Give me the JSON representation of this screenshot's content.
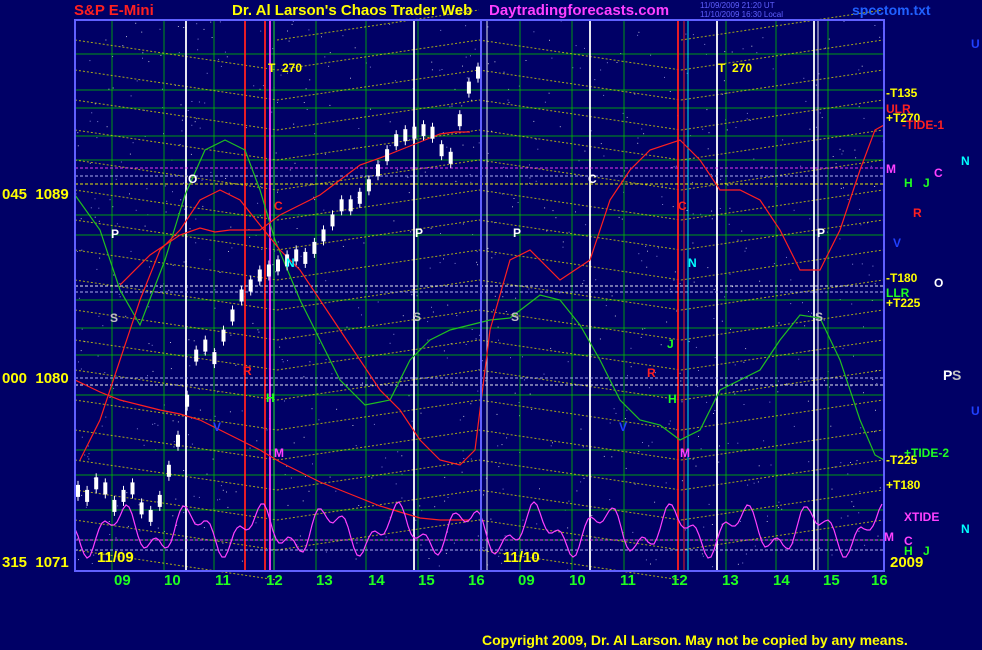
{
  "header": {
    "instrument": "S&P E-Mini",
    "title": "Dr. Al Larson's Chaos Trader Web",
    "site": "Daytradingforecasts.com",
    "stamp1": "11/09/2009 21:20 UT",
    "stamp2": "11/10/2009 16:30 Local",
    "file": "spcctom.txt"
  },
  "footer": {
    "copyright": "Copyright 2009, Dr. Al Larson. May not be copied by any means."
  },
  "y_labels": [
    {
      "deg": "045",
      "price": "1089"
    },
    {
      "deg": "000",
      "price": "1080"
    },
    {
      "deg": "315",
      "price": "1071"
    }
  ],
  "dates": {
    "day1": "11/09",
    "day2": "11/10",
    "year": "2009"
  },
  "x_ticks": [
    "09",
    "10",
    "11",
    "12",
    "13",
    "14",
    "15",
    "16",
    "09",
    "10",
    "11",
    "12",
    "13",
    "14",
    "15",
    "16"
  ],
  "top_markers": [
    {
      "text": "T  270"
    },
    {
      "text": "T  270"
    }
  ],
  "right_labels": [
    {
      "text": "-T135",
      "color": "#ffff00"
    },
    {
      "text": "ULR",
      "color": "#ff2020"
    },
    {
      "text": "+T270",
      "color": "#ffff00"
    },
    {
      "text": "-TIDE-1",
      "color": "#ff2020"
    },
    {
      "text": "M",
      "color": "#ff40ff"
    },
    {
      "text": "C",
      "color": "#ff40ff"
    },
    {
      "text": "N",
      "color": "#00ffff"
    },
    {
      "text": "H",
      "color": "#20ff20"
    },
    {
      "text": "J",
      "color": "#20ff20"
    },
    {
      "text": "R",
      "color": "#ff2020"
    },
    {
      "text": "V",
      "color": "#2040ff"
    },
    {
      "text": "-T180",
      "color": "#ffff00"
    },
    {
      "text": "LLR",
      "color": "#20ff20"
    },
    {
      "text": "+T225",
      "color": "#ffff00"
    },
    {
      "text": "O",
      "color": "#ffffff"
    },
    {
      "text": "P",
      "color": "#ffffff"
    },
    {
      "text": "S",
      "color": "#c0c0c0"
    },
    {
      "text": "U",
      "color": "#2040ff"
    },
    {
      "text": "U",
      "color": "#2040ff"
    },
    {
      "text": "-T225",
      "color": "#ffff00"
    },
    {
      "text": "+TIDE-2",
      "color": "#20ff20"
    },
    {
      "text": "+T180",
      "color": "#ffff00"
    },
    {
      "text": "XTIDE",
      "color": "#ff40ff"
    },
    {
      "text": "N",
      "color": "#00ffff"
    },
    {
      "text": "M",
      "color": "#ff40ff"
    },
    {
      "text": "C",
      "color": "#ff40ff"
    },
    {
      "text": "H",
      "color": "#20ff20"
    },
    {
      "text": "J",
      "color": "#20ff20"
    }
  ],
  "plot_letters": [
    {
      "text": "O",
      "color": "#ffffff"
    },
    {
      "text": "P",
      "color": "#ffffff"
    },
    {
      "text": "S",
      "color": "#c0c0c0"
    },
    {
      "text": "C",
      "color": "#ff2020"
    },
    {
      "text": "N",
      "color": "#00ffff"
    },
    {
      "text": "R",
      "color": "#ff2020"
    },
    {
      "text": "H",
      "color": "#20ff20"
    },
    {
      "text": "M",
      "color": "#ff40ff"
    },
    {
      "text": "V",
      "color": "#2040ff"
    },
    {
      "text": "P",
      "color": "#ffffff"
    },
    {
      "text": "S",
      "color": "#c0c0c0"
    },
    {
      "text": "P",
      "color": "#ffffff"
    },
    {
      "text": "S",
      "color": "#c0c0c0"
    },
    {
      "text": "C",
      "color": "#ffffff"
    },
    {
      "text": "C",
      "color": "#ff2020"
    },
    {
      "text": "N",
      "color": "#00ffff"
    },
    {
      "text": "J",
      "color": "#20ff20"
    },
    {
      "text": "R",
      "color": "#ff2020"
    },
    {
      "text": "H",
      "color": "#20ff20"
    },
    {
      "text": "M",
      "color": "#ff40ff"
    },
    {
      "text": "V",
      "color": "#2040ff"
    },
    {
      "text": "P",
      "color": "#ffffff"
    },
    {
      "text": "S",
      "color": "#c0c0c0"
    }
  ],
  "colors": {
    "background": "#000066",
    "plot_border": "#6060ff",
    "fib_lines": "#e0e000",
    "green_grid": "#00c000",
    "price_bars": "#ffffff",
    "tide1": "#ff2020",
    "tide2": "#20c020",
    "xtide": "#ff40ff",
    "time_label": "#ffff00",
    "date_label": "#ffff00"
  },
  "chart_data": {
    "type": "line",
    "y_axis": {
      "tick_labels": [
        "1071",
        "1080",
        "1089"
      ],
      "degree_labels": [
        "315",
        "000",
        "045"
      ],
      "range": [
        1071,
        1093
      ]
    },
    "x_axis": {
      "days": [
        "11/09",
        "11/10"
      ],
      "hour_ticks": [
        "09",
        "10",
        "11",
        "12",
        "13",
        "14",
        "15",
        "16"
      ]
    },
    "price_close": [
      1074.2,
      1074.0,
      1074.5,
      1074.3,
      1073.6,
      1074.0,
      1074.3,
      1073.5,
      1073.2,
      1073.8,
      1075.0,
      1076.2,
      1077.8,
      1079.6,
      1080.0,
      1079.5,
      1080.4,
      1081.2,
      1082.0,
      1082.4,
      1082.8,
      1083.0,
      1083.2,
      1083.4,
      1083.6,
      1083.5,
      1083.9,
      1084.4,
      1085.0,
      1085.6,
      1085.6,
      1085.9,
      1086.4,
      1087.0,
      1087.6,
      1088.2,
      1088.4,
      1088.5,
      1088.6,
      1088.5,
      1087.8,
      1087.5,
      1089.0,
      1090.3,
      1090.9
    ]
  }
}
